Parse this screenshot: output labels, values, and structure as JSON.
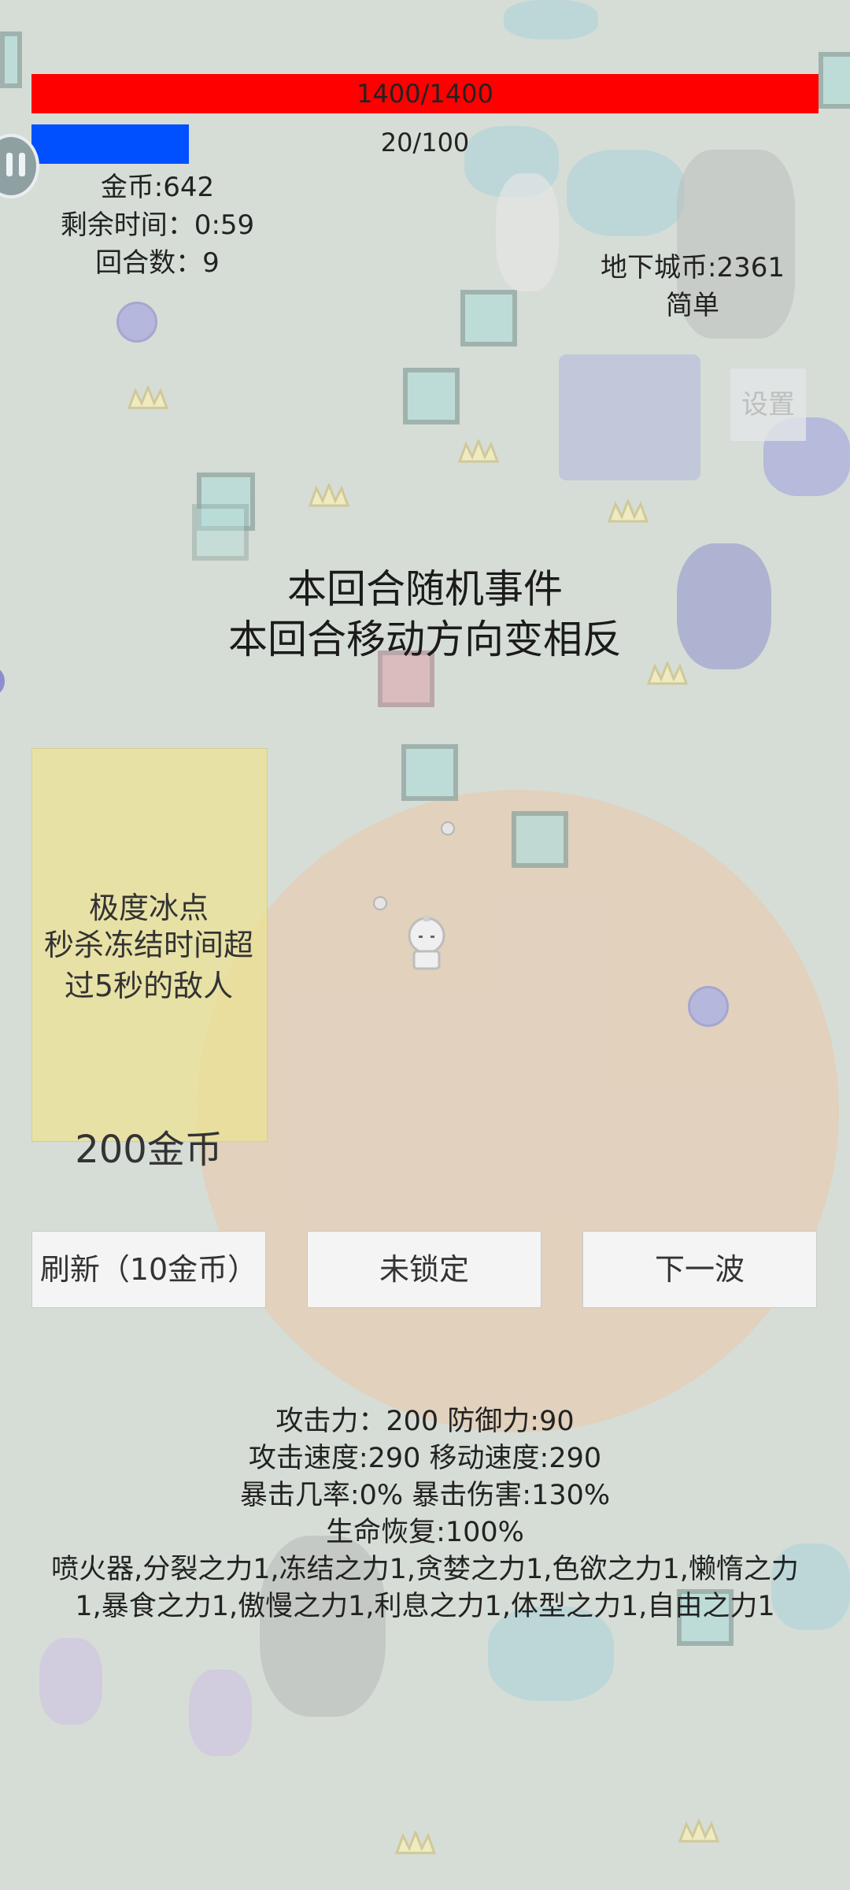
{
  "hud": {
    "hp_text": "1400/1400",
    "hp_fraction": 1.0,
    "xp_text": "20/100",
    "xp_fraction": 0.2,
    "coins": "金币:642",
    "time_left": "剩余时间：0:59",
    "round": "回合数：9",
    "dungeon_coins": "地下城币:2361",
    "difficulty": "简单",
    "settings_label": "设置"
  },
  "event": {
    "title": "本回合随机事件",
    "description": "本回合移动方向变相反"
  },
  "shop_card": {
    "name": "极度冰点",
    "description_line1": "秒杀冻结时间超",
    "description_line2": "过5秒的敌人",
    "price": "200金币"
  },
  "actions": {
    "refresh": "刷新（10金币）",
    "lock": "未锁定",
    "next_wave": "下一波"
  },
  "stats": {
    "line1": "攻击力：200 防御力:90",
    "line2": "攻击速度:290 移动速度:290",
    "line3": "暴击几率:0% 暴击伤害:130%",
    "line4": "生命恢复:100%",
    "line5": "喷火器,分裂之力1,冻结之力1,贪婪之力1,色欲之力1,懒惰之力1,暴食之力1,傲慢之力1,利息之力1,体型之力1,自由之力1"
  },
  "colors": {
    "hp": "#ff0000",
    "xp": "#0050ff",
    "background": "#d6ddd6",
    "card": "#ece296",
    "range_circle": "#f0c9a8"
  },
  "icons": {
    "pause": "pause-icon",
    "player": "player-sprite"
  }
}
